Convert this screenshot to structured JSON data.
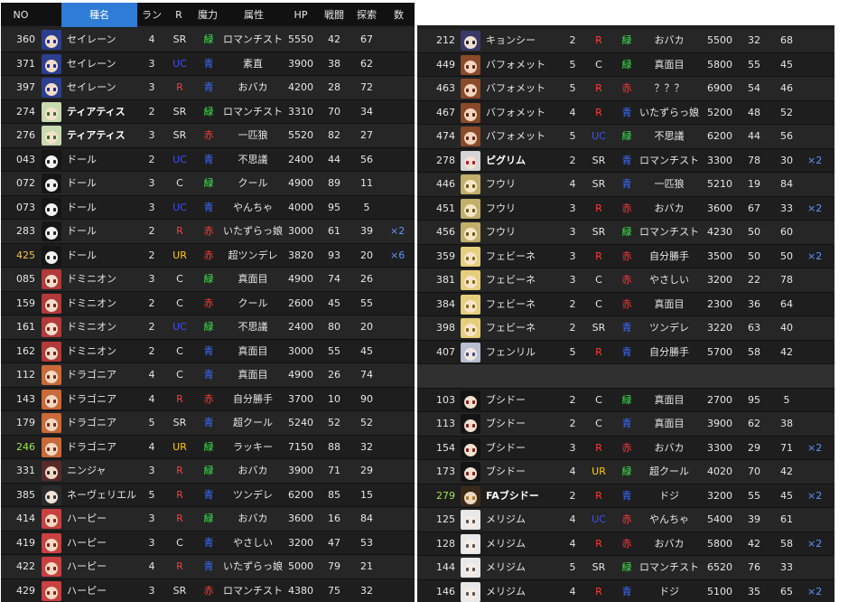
{
  "colors": {
    "no_special": {
      "425": "#f2c14a",
      "246": "#9ee64b",
      "279": "#9ee64b"
    },
    "rarity": {
      "SR": "#e6e6e6",
      "UC": "#3b4fff",
      "R": "#ff3b3b",
      "C": "#e6e6e6",
      "UR": "#ffcc00"
    },
    "magic": {
      "緑": "#39e64b",
      "青": "#3b6cff",
      "赤": "#ff3b3b"
    }
  },
  "headers": [
    "NO",
    "種名",
    "ランク",
    "R",
    "魔力",
    "属性",
    "HP",
    "戦闘",
    "探索",
    "数"
  ],
  "left_rows": [
    {
      "no": "360",
      "avatar": "avatar-blue-hair-icon",
      "name": "セイレーン",
      "bold": false,
      "rank": "4",
      "r": "SR",
      "magic": "緑",
      "attr": "ロマンチスト",
      "hp": "5550",
      "battle": "42",
      "search": "67",
      "count": ""
    },
    {
      "no": "371",
      "avatar": "avatar-blue-hair-icon",
      "name": "セイレーン",
      "bold": false,
      "rank": "3",
      "r": "UC",
      "magic": "青",
      "attr": "素直",
      "hp": "3900",
      "battle": "38",
      "search": "62",
      "count": ""
    },
    {
      "no": "397",
      "avatar": "avatar-blue-hair-icon",
      "name": "セイレーン",
      "bold": false,
      "rank": "3",
      "r": "R",
      "magic": "青",
      "attr": "おバカ",
      "hp": "4200",
      "battle": "28",
      "search": "72",
      "count": ""
    },
    {
      "no": "274",
      "avatar": "avatar-green-hair-icon",
      "name": "ティアティス",
      "bold": true,
      "rank": "2",
      "r": "SR",
      "magic": "緑",
      "attr": "ロマンチスト",
      "hp": "3310",
      "battle": "70",
      "search": "34",
      "count": ""
    },
    {
      "no": "276",
      "avatar": "avatar-green-hair-icon",
      "name": "ティアティス",
      "bold": true,
      "rank": "3",
      "r": "SR",
      "magic": "赤",
      "attr": "一匹狼",
      "hp": "5520",
      "battle": "82",
      "search": "27",
      "count": ""
    },
    {
      "no": "043",
      "avatar": "avatar-doll-icon",
      "name": "ドール",
      "bold": false,
      "rank": "2",
      "r": "UC",
      "magic": "青",
      "attr": "不思議",
      "hp": "2400",
      "battle": "44",
      "search": "56",
      "count": ""
    },
    {
      "no": "072",
      "avatar": "avatar-doll-icon",
      "name": "ドール",
      "bold": false,
      "rank": "3",
      "r": "C",
      "magic": "緑",
      "attr": "クール",
      "hp": "4900",
      "battle": "89",
      "search": "11",
      "count": ""
    },
    {
      "no": "073",
      "avatar": "avatar-doll-icon",
      "name": "ドール",
      "bold": false,
      "rank": "3",
      "r": "UC",
      "magic": "青",
      "attr": "やんちゃ",
      "hp": "4000",
      "battle": "95",
      "search": "5",
      "count": ""
    },
    {
      "no": "283",
      "avatar": "avatar-doll-icon",
      "name": "ドール",
      "bold": false,
      "rank": "2",
      "r": "R",
      "magic": "赤",
      "attr": "いたずらっ娘",
      "hp": "3000",
      "battle": "61",
      "search": "39",
      "count": "×2"
    },
    {
      "no": "425",
      "avatar": "avatar-doll-icon",
      "name": "ドール",
      "bold": false,
      "rank": "2",
      "r": "UR",
      "magic": "赤",
      "attr": "超ツンデレ",
      "hp": "3820",
      "battle": "93",
      "search": "20",
      "count": "×6"
    },
    {
      "no": "085",
      "avatar": "avatar-red-hair-icon",
      "name": "ドミニオン",
      "bold": false,
      "rank": "3",
      "r": "C",
      "magic": "緑",
      "attr": "真面目",
      "hp": "4900",
      "battle": "74",
      "search": "26",
      "count": ""
    },
    {
      "no": "159",
      "avatar": "avatar-red-hair-icon",
      "name": "ドミニオン",
      "bold": false,
      "rank": "2",
      "r": "C",
      "magic": "赤",
      "attr": "クール",
      "hp": "2600",
      "battle": "45",
      "search": "55",
      "count": ""
    },
    {
      "no": "161",
      "avatar": "avatar-red-hair-icon",
      "name": "ドミニオン",
      "bold": false,
      "rank": "2",
      "r": "UC",
      "magic": "緑",
      "attr": "不思議",
      "hp": "2400",
      "battle": "80",
      "search": "20",
      "count": ""
    },
    {
      "no": "162",
      "avatar": "avatar-red-hair-icon",
      "name": "ドミニオン",
      "bold": false,
      "rank": "2",
      "r": "C",
      "magic": "青",
      "attr": "真面目",
      "hp": "3000",
      "battle": "55",
      "search": "45",
      "count": ""
    },
    {
      "no": "112",
      "avatar": "avatar-brown-hair-icon",
      "name": "ドラゴニア",
      "bold": false,
      "rank": "4",
      "r": "C",
      "magic": "青",
      "attr": "真面目",
      "hp": "4900",
      "battle": "26",
      "search": "74",
      "count": ""
    },
    {
      "no": "143",
      "avatar": "avatar-brown-hair-icon",
      "name": "ドラゴニア",
      "bold": false,
      "rank": "4",
      "r": "R",
      "magic": "赤",
      "attr": "自分勝手",
      "hp": "3700",
      "battle": "10",
      "search": "90",
      "count": ""
    },
    {
      "no": "179",
      "avatar": "avatar-brown-hair-icon",
      "name": "ドラゴニア",
      "bold": false,
      "rank": "5",
      "r": "SR",
      "magic": "青",
      "attr": "超クール",
      "hp": "5240",
      "battle": "52",
      "search": "52",
      "count": ""
    },
    {
      "no": "246",
      "avatar": "avatar-brown-hair-icon",
      "name": "ドラゴニア",
      "bold": false,
      "rank": "4",
      "r": "UR",
      "magic": "緑",
      "attr": "ラッキー",
      "hp": "7150",
      "battle": "88",
      "search": "32",
      "count": ""
    },
    {
      "no": "331",
      "avatar": "avatar-ninja-icon",
      "name": "ニンジャ",
      "bold": false,
      "rank": "3",
      "r": "R",
      "magic": "緑",
      "attr": "おバカ",
      "hp": "3900",
      "battle": "71",
      "search": "29",
      "count": ""
    },
    {
      "no": "385",
      "avatar": "avatar-dark-hair-icon",
      "name": "ネーヴェリエル",
      "bold": false,
      "rank": "5",
      "r": "R",
      "magic": "青",
      "attr": "ツンデレ",
      "hp": "6200",
      "battle": "85",
      "search": "15",
      "count": ""
    },
    {
      "no": "414",
      "avatar": "avatar-harpy-icon",
      "name": "ハーピー",
      "bold": false,
      "rank": "3",
      "r": "R",
      "magic": "緑",
      "attr": "おバカ",
      "hp": "3600",
      "battle": "16",
      "search": "84",
      "count": ""
    },
    {
      "no": "419",
      "avatar": "avatar-harpy-icon",
      "name": "ハーピー",
      "bold": false,
      "rank": "3",
      "r": "C",
      "magic": "青",
      "attr": "やさしい",
      "hp": "3200",
      "battle": "47",
      "search": "53",
      "count": ""
    },
    {
      "no": "422",
      "avatar": "avatar-harpy-icon",
      "name": "ハーピー",
      "bold": false,
      "rank": "4",
      "r": "R",
      "magic": "青",
      "attr": "いたずらっ娘",
      "hp": "5000",
      "battle": "79",
      "search": "21",
      "count": ""
    },
    {
      "no": "429",
      "avatar": "avatar-harpy-icon",
      "name": "ハーピー",
      "bold": false,
      "rank": "3",
      "r": "SR",
      "magic": "赤",
      "attr": "ロマンチスト",
      "hp": "4380",
      "battle": "75",
      "search": "32",
      "count": ""
    }
  ],
  "right_rows": [
    {
      "no": "212",
      "avatar": "avatar-jiangshi-icon",
      "name": "キョンシー",
      "bold": false,
      "rank": "2",
      "r": "R",
      "magic": "緑",
      "attr": "おバカ",
      "hp": "5500",
      "battle": "32",
      "search": "68",
      "count": ""
    },
    {
      "no": "449",
      "avatar": "avatar-baphomet-icon",
      "name": "バフォメット",
      "bold": false,
      "rank": "5",
      "r": "C",
      "magic": "緑",
      "attr": "真面目",
      "hp": "5800",
      "battle": "55",
      "search": "45",
      "count": ""
    },
    {
      "no": "463",
      "avatar": "avatar-baphomet-icon",
      "name": "バフォメット",
      "bold": false,
      "rank": "5",
      "r": "R",
      "magic": "赤",
      "attr": "？？？",
      "hp": "6900",
      "battle": "54",
      "search": "46",
      "count": ""
    },
    {
      "no": "467",
      "avatar": "avatar-baphomet-icon",
      "name": "バフォメット",
      "bold": false,
      "rank": "4",
      "r": "R",
      "magic": "青",
      "attr": "いたずらっ娘",
      "hp": "5200",
      "battle": "48",
      "search": "52",
      "count": ""
    },
    {
      "no": "474",
      "avatar": "avatar-baphomet-icon",
      "name": "バフォメット",
      "bold": false,
      "rank": "5",
      "r": "UC",
      "magic": "緑",
      "attr": "不思議",
      "hp": "6200",
      "battle": "44",
      "search": "56",
      "count": ""
    },
    {
      "no": "278",
      "avatar": "avatar-pilgrim-icon",
      "name": "ピグリム",
      "bold": true,
      "rank": "2",
      "r": "SR",
      "magic": "青",
      "attr": "ロマンチスト",
      "hp": "3300",
      "battle": "78",
      "search": "30",
      "count": "×2"
    },
    {
      "no": "446",
      "avatar": "avatar-fuuri-icon",
      "name": "フウリ",
      "bold": false,
      "rank": "4",
      "r": "SR",
      "magic": "青",
      "attr": "一匹狼",
      "hp": "5210",
      "battle": "19",
      "search": "84",
      "count": ""
    },
    {
      "no": "451",
      "avatar": "avatar-fuuri-icon",
      "name": "フウリ",
      "bold": false,
      "rank": "3",
      "r": "R",
      "magic": "赤",
      "attr": "おバカ",
      "hp": "3600",
      "battle": "67",
      "search": "33",
      "count": "×2"
    },
    {
      "no": "456",
      "avatar": "avatar-fuuri-icon",
      "name": "フウリ",
      "bold": false,
      "rank": "3",
      "r": "SR",
      "magic": "緑",
      "attr": "ロマンチスト",
      "hp": "4230",
      "battle": "50",
      "search": "60",
      "count": ""
    },
    {
      "no": "359",
      "avatar": "avatar-blonde-hair-icon",
      "name": "フェビーネ",
      "bold": false,
      "rank": "3",
      "r": "R",
      "magic": "赤",
      "attr": "自分勝手",
      "hp": "3500",
      "battle": "50",
      "search": "50",
      "count": "×2"
    },
    {
      "no": "381",
      "avatar": "avatar-blonde-hair-icon",
      "name": "フェビーネ",
      "bold": false,
      "rank": "3",
      "r": "C",
      "magic": "赤",
      "attr": "やさしい",
      "hp": "3200",
      "battle": "22",
      "search": "78",
      "count": ""
    },
    {
      "no": "384",
      "avatar": "avatar-blonde-hair-icon",
      "name": "フェビーネ",
      "bold": false,
      "rank": "2",
      "r": "C",
      "magic": "赤",
      "attr": "真面目",
      "hp": "2300",
      "battle": "36",
      "search": "64",
      "count": ""
    },
    {
      "no": "398",
      "avatar": "avatar-blonde-hair-icon",
      "name": "フェビーネ",
      "bold": false,
      "rank": "2",
      "r": "SR",
      "magic": "青",
      "attr": "ツンデレ",
      "hp": "3220",
      "battle": "63",
      "search": "40",
      "count": ""
    },
    {
      "no": "407",
      "avatar": "avatar-silver-hair-icon",
      "name": "フェンリル",
      "bold": false,
      "rank": "5",
      "r": "R",
      "magic": "青",
      "attr": "自分勝手",
      "hp": "5700",
      "battle": "58",
      "search": "42",
      "count": ""
    },
    {
      "spacer": true
    },
    {
      "no": "103",
      "avatar": "avatar-black-hair-icon",
      "name": "ブシドー",
      "bold": false,
      "rank": "2",
      "r": "C",
      "magic": "緑",
      "attr": "真面目",
      "hp": "2700",
      "battle": "95",
      "search": "5",
      "count": ""
    },
    {
      "no": "113",
      "avatar": "avatar-black-hair-icon",
      "name": "ブシドー",
      "bold": false,
      "rank": "2",
      "r": "C",
      "magic": "青",
      "attr": "真面目",
      "hp": "3900",
      "battle": "62",
      "search": "38",
      "count": ""
    },
    {
      "no": "154",
      "avatar": "avatar-black-hair-icon",
      "name": "ブシドー",
      "bold": false,
      "rank": "3",
      "r": "R",
      "magic": "赤",
      "attr": "おバカ",
      "hp": "3300",
      "battle": "29",
      "search": "71",
      "count": "×2"
    },
    {
      "no": "173",
      "avatar": "avatar-black-hair-icon",
      "name": "ブシドー",
      "bold": false,
      "rank": "4",
      "r": "UR",
      "magic": "緑",
      "attr": "超クール",
      "hp": "4020",
      "battle": "70",
      "search": "42",
      "count": ""
    },
    {
      "no": "279",
      "avatar": "avatar-fa-bushido-icon",
      "name": "FAブシドー",
      "bold": true,
      "rank": "2",
      "r": "R",
      "magic": "青",
      "attr": "ドジ",
      "hp": "3200",
      "battle": "55",
      "search": "45",
      "count": "×2"
    },
    {
      "no": "125",
      "avatar": "avatar-white-hair-icon",
      "name": "メリジム",
      "bold": false,
      "rank": "4",
      "r": "UC",
      "magic": "赤",
      "attr": "やんちゃ",
      "hp": "5400",
      "battle": "39",
      "search": "61",
      "count": ""
    },
    {
      "no": "128",
      "avatar": "avatar-white-hair-icon",
      "name": "メリジム",
      "bold": false,
      "rank": "4",
      "r": "R",
      "magic": "赤",
      "attr": "おバカ",
      "hp": "5800",
      "battle": "42",
      "search": "58",
      "count": "×2"
    },
    {
      "no": "144",
      "avatar": "avatar-white-hair-icon",
      "name": "メリジム",
      "bold": false,
      "rank": "5",
      "r": "SR",
      "magic": "緑",
      "attr": "ロマンチスト",
      "hp": "6520",
      "battle": "76",
      "search": "33",
      "count": ""
    },
    {
      "no": "146",
      "avatar": "avatar-white-hair-icon",
      "name": "メリジム",
      "bold": false,
      "rank": "4",
      "r": "R",
      "magic": "青",
      "attr": "ドジ",
      "hp": "5100",
      "battle": "35",
      "search": "65",
      "count": "×2"
    }
  ]
}
